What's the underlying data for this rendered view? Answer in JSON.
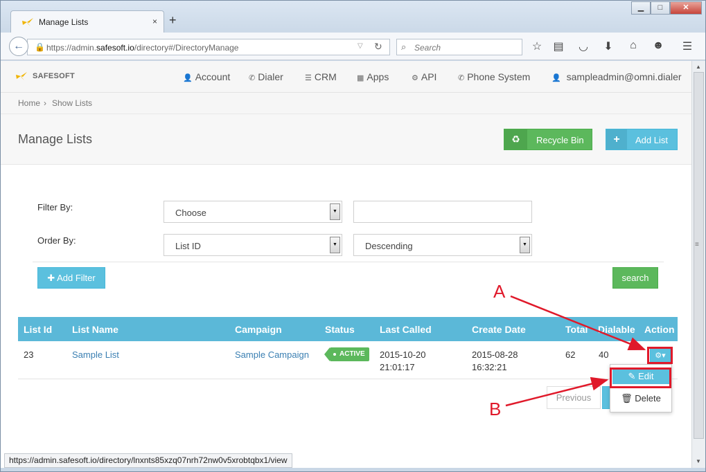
{
  "browser": {
    "tab_title": "Manage Lists",
    "tab_close": "×",
    "new_tab": "+",
    "url_prefix": "https://admin.",
    "url_domain": "safesoft.io",
    "url_path": "/directory#/DirectoryManage",
    "search_placeholder": "Search",
    "status_url": "https://admin.safesoft.io/directory/lnxnts85xzq07nrh72nw0v5xrobtqbx1/view",
    "window_buttons": {
      "minimize": "▁",
      "maximize": "□",
      "close": "✕"
    }
  },
  "app": {
    "brand": "SAFESOFT",
    "nav": [
      {
        "label": "Account",
        "icon": "user-icon"
      },
      {
        "label": "Dialer",
        "icon": "phone-icon"
      },
      {
        "label": "CRM",
        "icon": "list-icon"
      },
      {
        "label": "Apps",
        "icon": "grid-icon"
      },
      {
        "label": "API",
        "icon": "gear-icon"
      },
      {
        "label": "Phone System",
        "icon": "phone-icon"
      },
      {
        "label": "sampleadmin@omni.dialer",
        "icon": "user-icon"
      }
    ],
    "breadcrumb": {
      "home": "Home",
      "sep": "›",
      "current": "Show Lists"
    }
  },
  "page": {
    "title": "Manage Lists",
    "recycle_bin": "Recycle Bin",
    "add_list": "Add List",
    "filter_by_label": "Filter By:",
    "filter_by_value": "Choose",
    "filter_text_value": "",
    "order_by_label": "Order By:",
    "order_by_value": "List ID",
    "order_dir_value": "Descending",
    "add_filter": "Add Filter",
    "search": "search"
  },
  "table": {
    "headers": [
      "List Id",
      "List Name",
      "Campaign",
      "Status",
      "Last Called",
      "Create Date",
      "Total",
      "Dialable",
      "Action"
    ],
    "rows": [
      {
        "list_id": "23",
        "list_name": "Sample List",
        "campaign": "Sample Campaign",
        "status": "ACTIVE",
        "last_called_date": "2015-10-20",
        "last_called_time": "21:01:17",
        "create_date": "2015-08-28",
        "create_time": "16:32:21",
        "total": "62",
        "dialable": "40"
      }
    ],
    "pager_previous": "Previous",
    "action_menu": {
      "edit": "Edit",
      "delete": "Delete"
    }
  },
  "annotations": {
    "a": "A",
    "b": "B"
  },
  "colors": {
    "accent": "#5bc0de",
    "success": "#5cb85c",
    "callout": "#e0192a",
    "link": "#3a7fb2"
  }
}
